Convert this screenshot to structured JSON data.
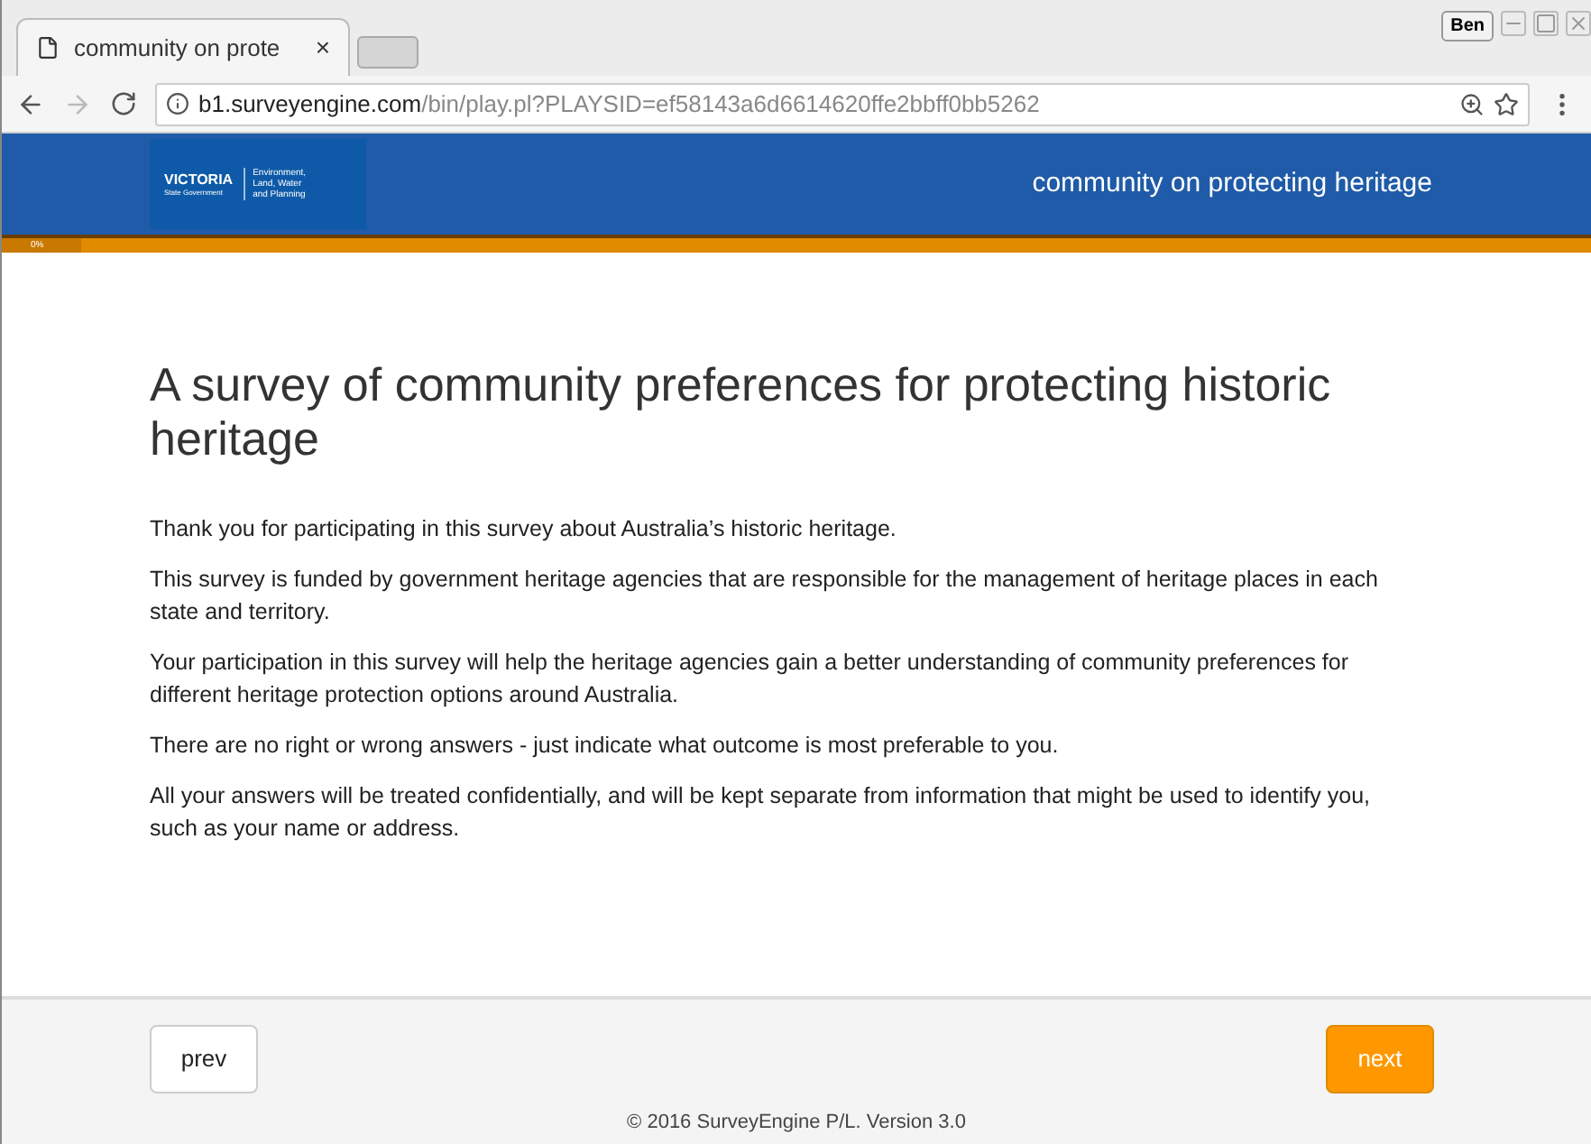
{
  "browser": {
    "tab_title": "community on prote",
    "tab_close": "×",
    "user": "Ben",
    "url_host": "b1.surveyengine.com",
    "url_path": "/bin/play.pl?PLAYSID=ef58143a6d6614620ffe2bbff0bb5262"
  },
  "header": {
    "logo": {
      "name": "VICTORIA",
      "sub": "State Government",
      "dept": [
        "Environment,",
        "Land, Water",
        "and Planning"
      ]
    },
    "title": "community on protecting heritage"
  },
  "progress": {
    "label": "0%",
    "level": 0.05
  },
  "heading": "A survey of community preferences for protecting historic heritage",
  "paragraphs": [
    "Thank you for participating in this survey about Australia’s historic heritage.",
    "This survey is funded by government heritage agencies that are responsible for the management of heritage places in each state and territory.",
    "Your participation in this survey will help the heritage agencies gain a better understanding of community preferences for different heritage protection options around Australia.",
    "There are no right or wrong answers - just indicate what outcome is most preferable to you.",
    "All your answers will be treated confidentially, and will be kept separate from information that might be used to identify you, such as your name or address."
  ],
  "buttons": {
    "prev": "prev",
    "next": "next"
  },
  "footer": "© 2016 SurveyEngine P/L. Version 3.0"
}
